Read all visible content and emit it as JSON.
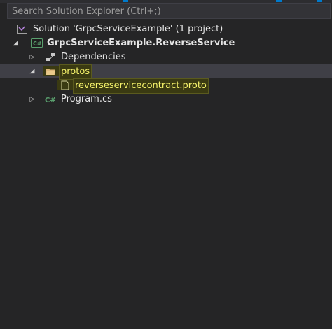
{
  "search": {
    "placeholder": "Search Solution Explorer (Ctrl+;)"
  },
  "tree": {
    "solution_label": "Solution 'GrpcServiceExample' (1 project)",
    "project_label": "GrpcServiceExample.ReverseService",
    "dependencies_label": "Dependencies",
    "protos_label": "protos",
    "proto_file_label": "reverseservicecontract.proto",
    "program_label": "Program.cs"
  },
  "colors": {
    "background": "#252526",
    "selection": "#3f3f46",
    "highlight_text": "#f6f36b",
    "accent": "#007acc"
  },
  "icons": {
    "solution": "visual-studio-solution-icon",
    "project": "csharp-project-icon",
    "dependencies": "dependencies-icon",
    "folder": "folder-open-icon",
    "file": "file-icon",
    "csharp_file": "csharp-file-icon"
  }
}
